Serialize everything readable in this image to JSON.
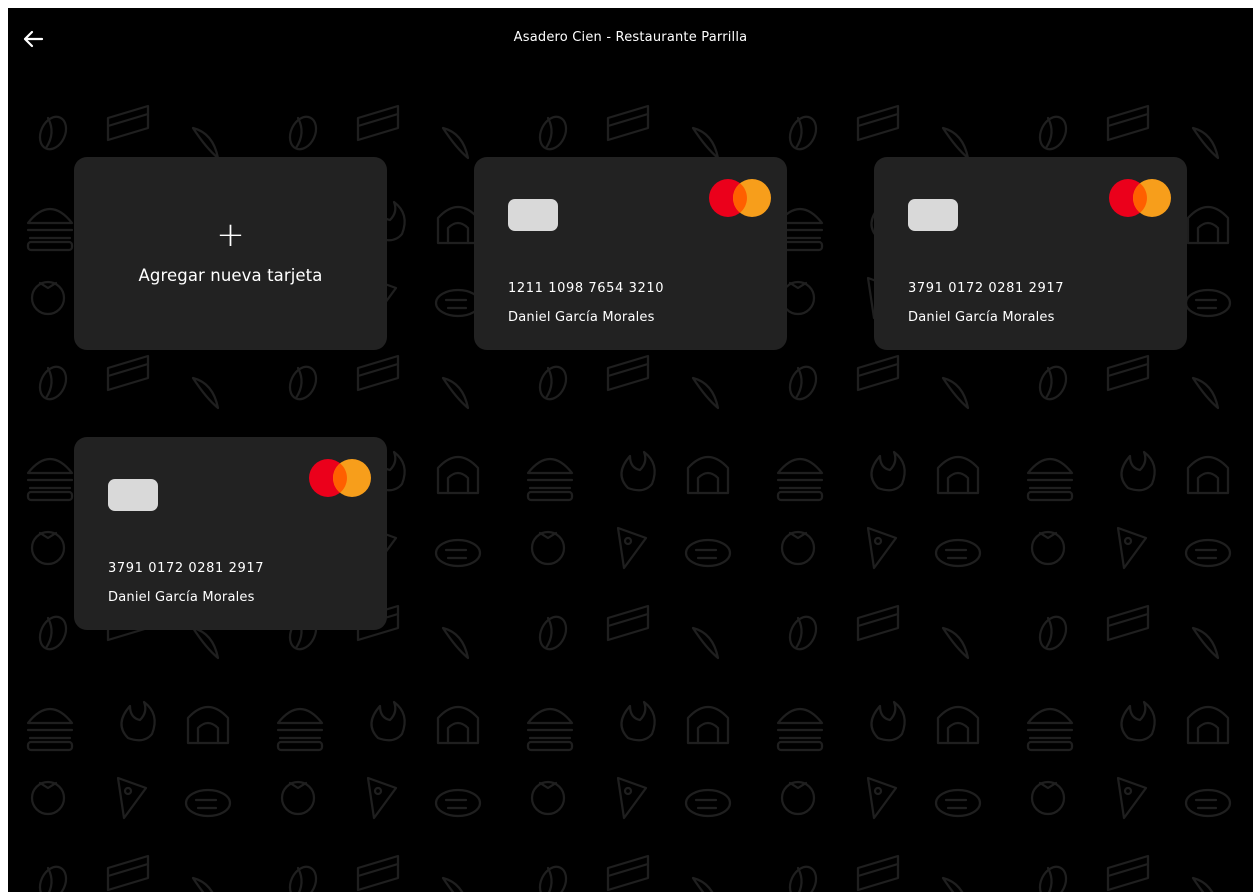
{
  "header": {
    "title": "Asadero Cien - Restaurante Parrilla",
    "back_icon": "arrow-left-icon"
  },
  "add_card": {
    "icon": "plus-icon",
    "plus_symbol": "+",
    "label": "Agregar nueva tarjeta"
  },
  "cards": [
    {
      "number": "1211 1098 7654 3210",
      "holder": "Daniel García Morales",
      "brand_icon": "mastercard-logo-icon"
    },
    {
      "number": "3791 0172 0281 2917",
      "holder": "Daniel García Morales",
      "brand_icon": "mastercard-logo-icon"
    },
    {
      "number": "3791 0172 0281 2917",
      "holder": "Daniel García Morales",
      "brand_icon": "mastercard-logo-icon"
    }
  ],
  "colors": {
    "background": "#000000",
    "card": "#222222",
    "chip": "#d9d9d9",
    "mastercard_red": "#eb001b",
    "mastercard_orange": "#f79e1b",
    "pattern_stroke": "#1f1f1f"
  }
}
